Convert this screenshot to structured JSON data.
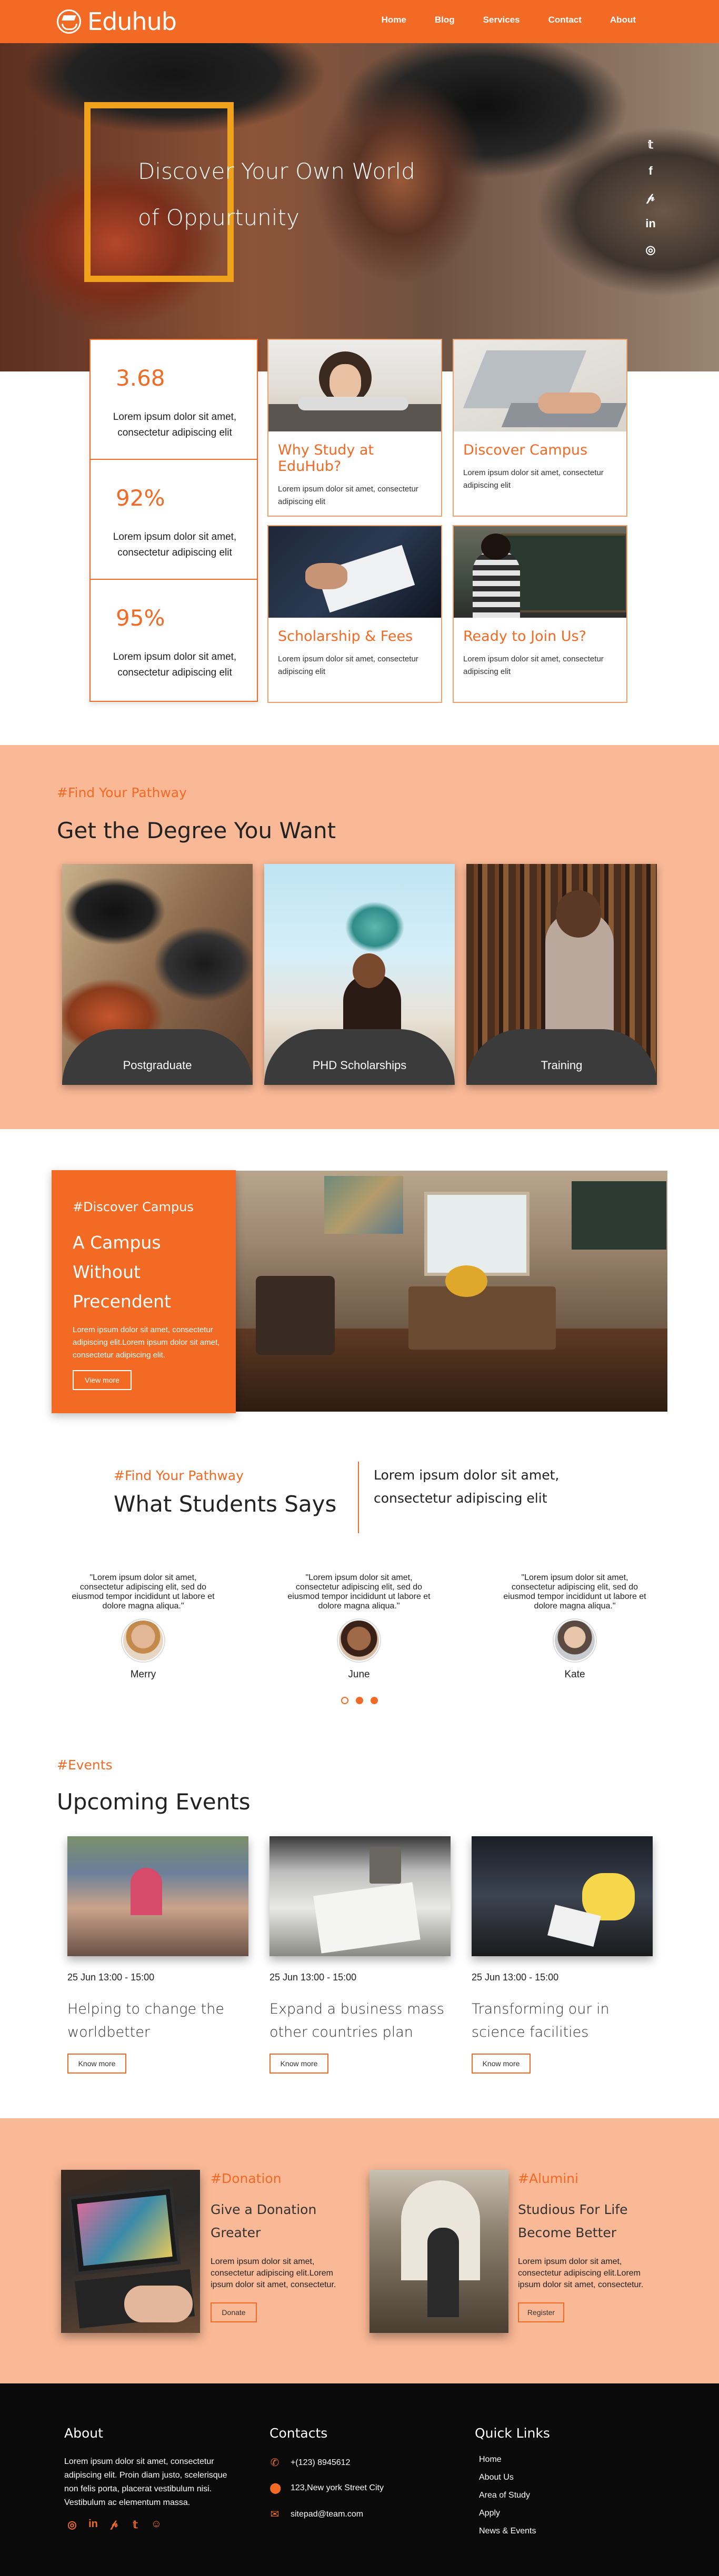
{
  "header": {
    "brand": "Eduhub",
    "nav": [
      "Home",
      "Blog",
      "Services",
      "Contact",
      "About"
    ],
    "accent": "#f26a24"
  },
  "hero": {
    "title_line1": "Discover Your Own World",
    "title_line2": "of Oppurtunity",
    "frame_color": "#f1a21c",
    "social_icons": [
      "twitter-icon",
      "facebook-icon",
      "pinterest-icon",
      "linkedin-icon",
      "instagram-icon"
    ]
  },
  "stats": [
    {
      "value": "3.68",
      "text": "Lorem ipsum dolor sit amet, consectetur adipiscing elit"
    },
    {
      "value": "92%",
      "text": "Lorem ipsum dolor sit amet, consectetur adipiscing elit"
    },
    {
      "value": "95%",
      "text": "Lorem ipsum dolor sit amet, consectetur adipiscing elit"
    }
  ],
  "cards": [
    {
      "title": "Why Study at EduHub?",
      "text": "Lorem ipsum dolor sit amet, consectetur adipiscing elit"
    },
    {
      "title": "Discover Campus",
      "text": "Lorem ipsum dolor sit amet, consectetur adipiscing elit"
    },
    {
      "title": "Scholarship & Fees",
      "text": "Lorem ipsum dolor sit amet, consectetur adipiscing elit"
    },
    {
      "title": "Ready to Join Us?",
      "text": "Lorem ipsum dolor sit amet, consectetur adipiscing elit"
    }
  ],
  "pathway": {
    "tag": "#Find Your Pathway",
    "title": "Get the Degree You Want",
    "degrees": [
      "Postgraduate",
      "PHD Scholarships",
      "Training"
    ]
  },
  "campus": {
    "tag": "#Discover Campus",
    "title": "A Campus Without Precendent",
    "text": "Lorem ipsum dolor sit amet, consectetur adipiscing elit.Lorem ipsum dolor sit amet, consectetur adipiscing elit.",
    "button": "View more"
  },
  "testimonials": {
    "tag": "#Find Your Pathway",
    "title": "What Students Says",
    "side_text": "Lorem ipsum dolor sit amet, consectetur adipiscing elit",
    "items": [
      {
        "quote": "\"Lorem ipsum dolor sit amet, consectetur adipiscing elit, sed do eiusmod tempor incididunt ut labore et dolore magna aliqua.\"",
        "name": "Merry"
      },
      {
        "quote": "\"Lorem ipsum dolor sit amet, consectetur adipiscing elit, sed do eiusmod tempor incididunt ut labore et dolore magna aliqua.\"",
        "name": "June"
      },
      {
        "quote": "\"Lorem ipsum dolor sit amet, consectetur adipiscing elit, sed do eiusmod tempor incididunt ut labore et dolore magna aliqua.\"",
        "name": "Kate"
      }
    ],
    "carousel_active_index": 0
  },
  "events": {
    "tag": "#Events",
    "title": "Upcoming Events",
    "items": [
      {
        "date": "25 Jun 13:00 - 15:00",
        "title": "Helping to change the worldbetter",
        "button": "Know more"
      },
      {
        "date": "25 Jun 13:00 - 15:00",
        "title": "Expand a business mass other countries plan",
        "button": "Know more"
      },
      {
        "date": "25 Jun 13:00 - 15:00",
        "title": "Transforming our in science facilities",
        "button": "Know more"
      }
    ]
  },
  "donation": {
    "tag": "#Donation",
    "title": "Give a Donation Greater",
    "text": "Lorem ipsum dolor sit amet, consectetur adipiscing elit.Lorem ipsum dolor sit amet, consectetur.",
    "button": "Donate"
  },
  "alumni": {
    "tag": "#Alumini",
    "title": "Studious For Life Become Better",
    "text": "Lorem ipsum dolor sit amet, consectetur adipiscing elit.Lorem ipsum dolor sit amet, consectetur.",
    "button": "Register"
  },
  "footer": {
    "about_title": "About",
    "about_text": "Lorem ipsum dolor sit amet, consectetur adipiscing elit. Proin diam justo, scelerisque non felis porta, placerat vestibulum nisi. Vestibulum ac elementum massa.",
    "social_icons": [
      "instagram-icon",
      "linkedin-icon",
      "pinterest-icon",
      "twitter-icon",
      "snapchat-icon"
    ],
    "contacts_title": "Contacts",
    "phone": "+(123) 8945612",
    "address": "123,New york Street City",
    "email": "sitepad@team.com",
    "links_title": "Quick Links",
    "links": [
      "Home",
      "About Us",
      "Area of Study",
      "Apply",
      "News & Events"
    ]
  }
}
